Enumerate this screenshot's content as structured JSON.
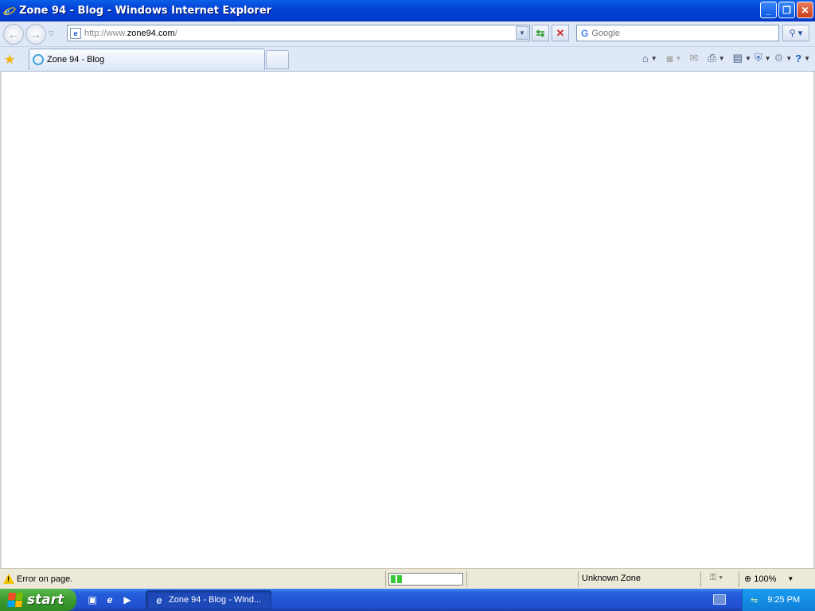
{
  "window": {
    "title": "Zone 94 - Blog - Windows Internet Explorer",
    "buttons": {
      "minimize": "_",
      "restore": "❐",
      "close": "✕"
    }
  },
  "address": {
    "url_prefix": "http://www.",
    "url_host": "zone94.com",
    "url_suffix": "/",
    "search_placeholder": "Google"
  },
  "tabs": [
    {
      "title": "Zone 94 - Blog",
      "loading": true
    }
  ],
  "status": {
    "message": "Error on page.",
    "zone": "Unknown Zone",
    "zoom": "100%",
    "progress_fraction": 0.15
  },
  "taskbar": {
    "start_label": "start",
    "task_button": "Zone 94 - Blog - Wind...",
    "clock": "9:25 PM"
  },
  "colors": {
    "titlebar": "#0343d8",
    "chrome": "#dfe8f6",
    "statusbar": "#ece9d8",
    "taskbar": "#245edb",
    "start": "#3d9a30"
  }
}
